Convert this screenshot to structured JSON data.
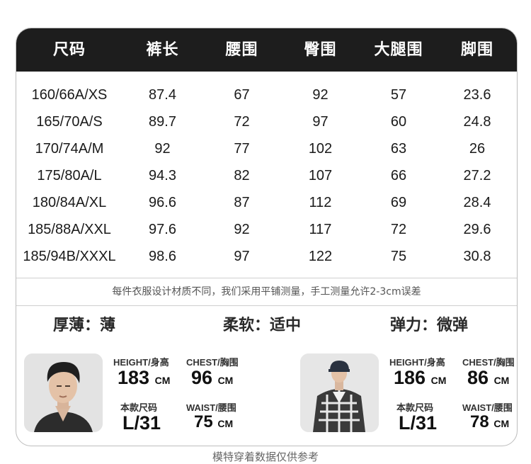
{
  "table": {
    "headers": [
      "尺码",
      "裤长",
      "腰围",
      "臀围",
      "大腿围",
      "脚围"
    ],
    "rows": [
      [
        "160/66A/XS",
        "87.4",
        "67",
        "92",
        "57",
        "23.6"
      ],
      [
        "165/70A/S",
        "89.7",
        "72",
        "97",
        "60",
        "24.8"
      ],
      [
        "170/74A/M",
        "92",
        "77",
        "102",
        "63",
        "26"
      ],
      [
        "175/80A/L",
        "94.3",
        "82",
        "107",
        "66",
        "27.2"
      ],
      [
        "180/84A/XL",
        "96.6",
        "87",
        "112",
        "69",
        "28.4"
      ],
      [
        "185/88A/XXL",
        "97.6",
        "92",
        "117",
        "72",
        "29.6"
      ],
      [
        "185/94B/XXXL",
        "98.6",
        "97",
        "122",
        "75",
        "30.8"
      ]
    ]
  },
  "note": "每件衣服设计材质不同，我们采用平铺测量，手工测量允许2-3cm误差",
  "attributes": [
    {
      "text": "厚薄：薄"
    },
    {
      "text": "柔软：适中"
    },
    {
      "text": "弹力：微弹"
    }
  ],
  "models": [
    {
      "height_label": "HEIGHT/身高",
      "height_value": "183",
      "height_unit": "CM",
      "chest_label": "CHEST/胸围",
      "chest_value": "96",
      "chest_unit": "CM",
      "size_label": "本款尺码",
      "size_value": "L/31",
      "waist_label": "WAIST/腰围",
      "waist_value": "75",
      "waist_unit": "CM"
    },
    {
      "height_label": "HEIGHT/身高",
      "height_value": "186",
      "height_unit": "CM",
      "chest_label": "CHEST/胸围",
      "chest_value": "86",
      "chest_unit": "CM",
      "size_label": "本款尺码",
      "size_value": "L/31",
      "waist_label": "WAIST/腰围",
      "waist_value": "78",
      "waist_unit": "CM"
    }
  ],
  "footer": "模特穿着数据仅供参考",
  "colors": {
    "header_bg": "#1d1d1d",
    "header_text": "#ffffff",
    "border": "#bdbdbd"
  }
}
